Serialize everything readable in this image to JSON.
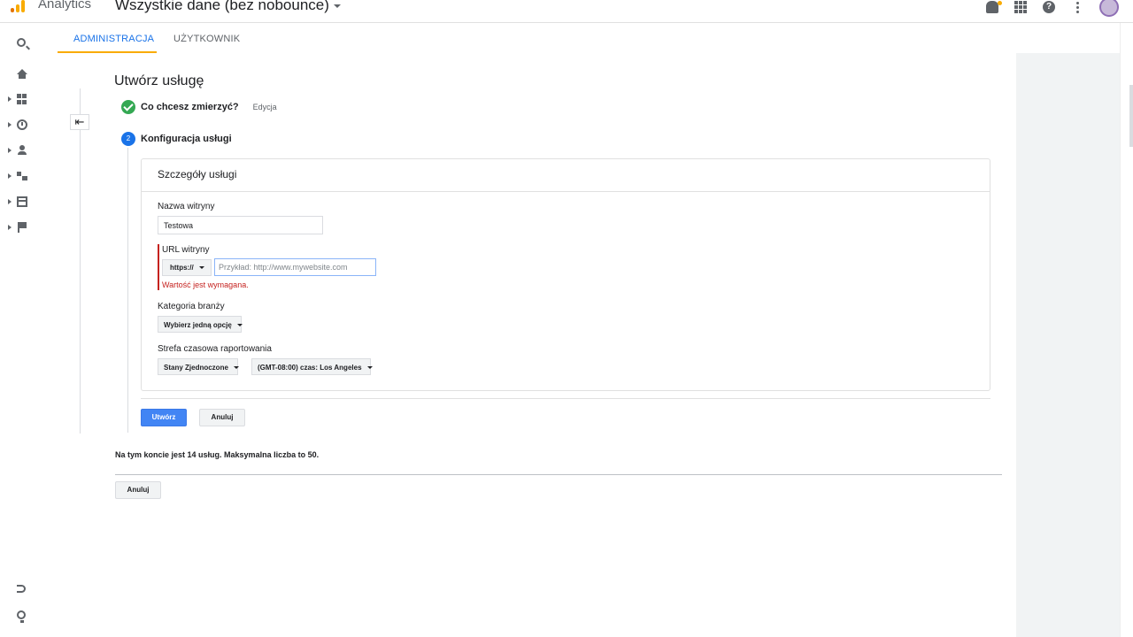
{
  "header": {
    "app_name": "Analytics",
    "account_selector": "Wszystkie dane (bez nobounce)"
  },
  "tabs": [
    {
      "label": "ADMINISTRACJA",
      "active": true
    },
    {
      "label": "UŻYTKOWNIK",
      "active": false
    }
  ],
  "page": {
    "title": "Utwórz usługę",
    "steps": [
      {
        "label": "Co chcesz zmierzyć?",
        "status": "done",
        "edit_label": "Edycja"
      },
      {
        "number": "2",
        "label": "Konfiguracja usługi",
        "status": "active"
      }
    ]
  },
  "details": {
    "heading": "Szczegóły usługi",
    "site_name_label": "Nazwa witryny",
    "site_name_value": "Testowa",
    "url_label": "URL witryny",
    "protocol": "https://",
    "url_placeholder": "Przykład: http://www.mywebsite.com",
    "url_error": "Wartość jest wymagana.",
    "category_label": "Kategoria branży",
    "category_value": "Wybierz jedną opcję",
    "timezone_label": "Strefa czasowa raportowania",
    "country_value": "Stany Zjednoczone",
    "timezone_value": "(GMT-08:00) czas: Los Angeles"
  },
  "actions": {
    "create": "Utwórz",
    "cancel": "Anuluj"
  },
  "footer": {
    "quota_text": "Na tym koncie jest 14 usług. Maksymalna liczba to 50.",
    "cancel": "Anuluj"
  },
  "colors": {
    "accent": "#1a73e8",
    "primary_button": "#4285f4",
    "error": "#c5221f",
    "success": "#34a853",
    "tab_underline": "#f9ab00"
  }
}
